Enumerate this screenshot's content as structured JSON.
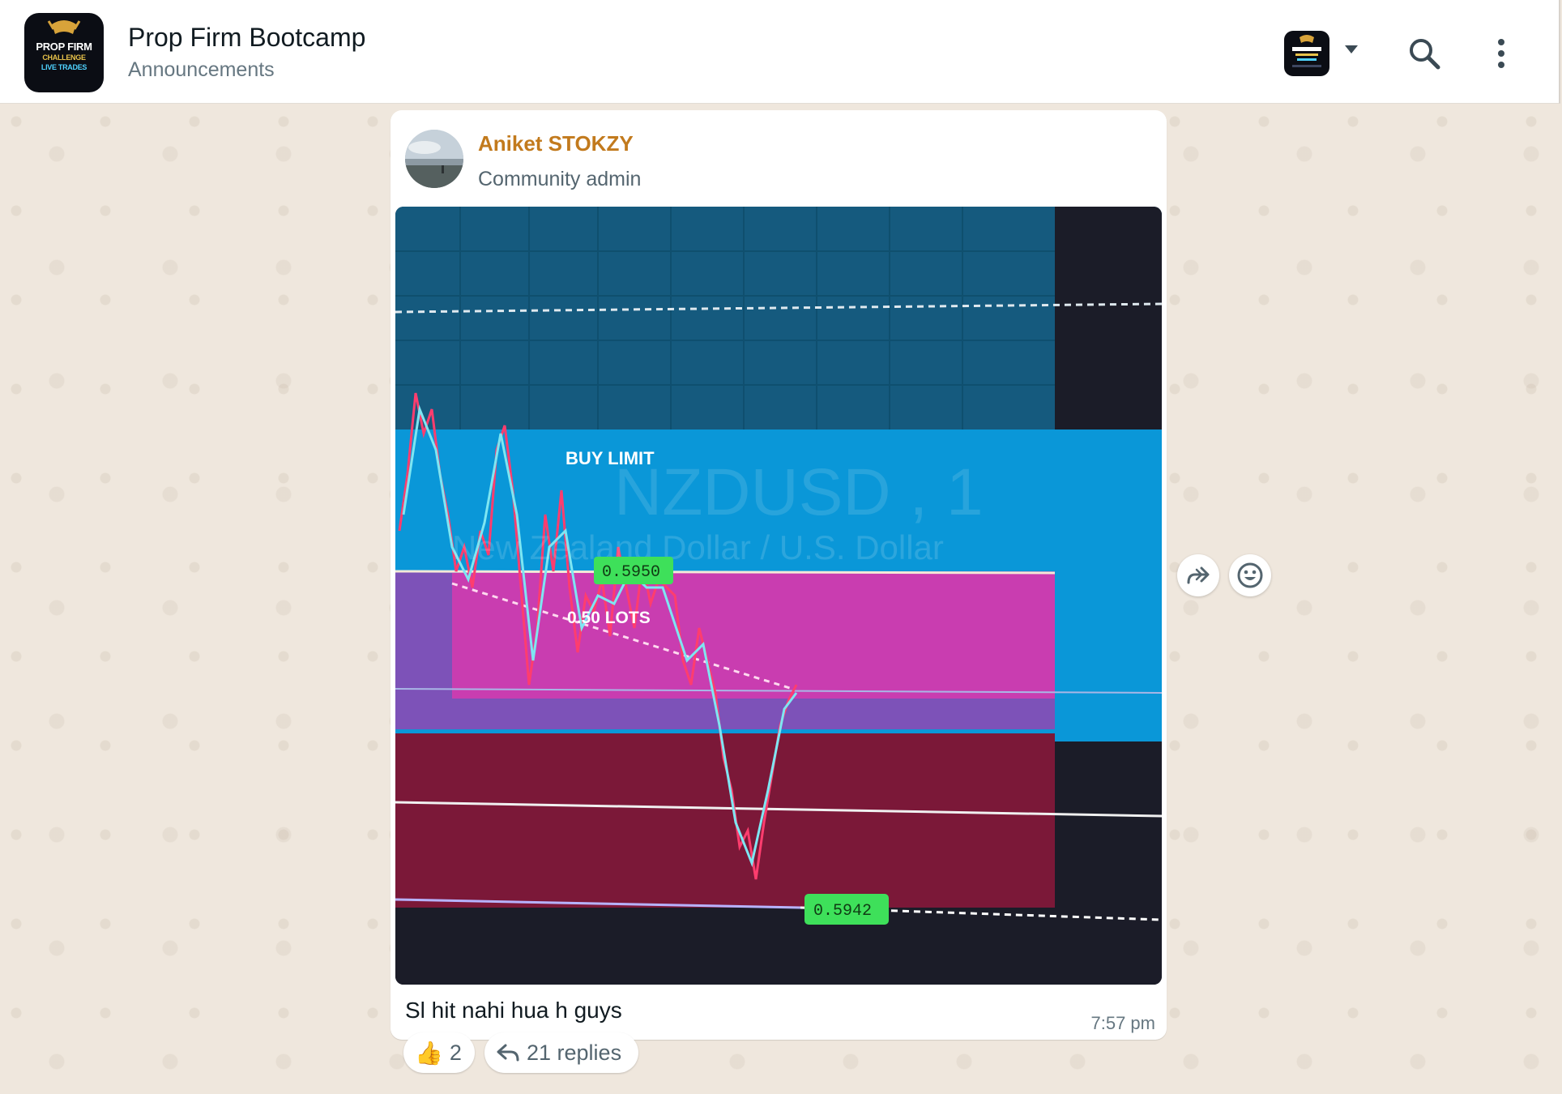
{
  "header": {
    "title": "Prop Firm Bootcamp",
    "subtitle": "Announcements",
    "logo_lines": [
      "PROP FIRM",
      "CHALLENGE",
      "LIVE TRADES"
    ]
  },
  "message": {
    "sender_name": "Aniket STOKZY",
    "sender_role": "Community admin",
    "caption": "Sl hit nahi hua h guys",
    "time": "7:57 pm",
    "image": {
      "labels": {
        "buy_limit": "BUY LIMIT",
        "entry_price": "0.5950",
        "lots": "0.50 LOTS",
        "stop_price": "0.5942",
        "watermark_symbol": "NZDUSD , 1",
        "watermark_desc": "New Zealand Dollar / U.S. Dollar"
      }
    }
  },
  "reactions": {
    "emoji": "👍",
    "count": "2",
    "replies": "21 replies"
  },
  "colors": {
    "sender_name": "#c27a1d",
    "zone_blue": "#0a97d8",
    "zone_magenta": "#c93db0",
    "zone_maroon": "#7b1838",
    "price_tag": "#3ee05a"
  }
}
